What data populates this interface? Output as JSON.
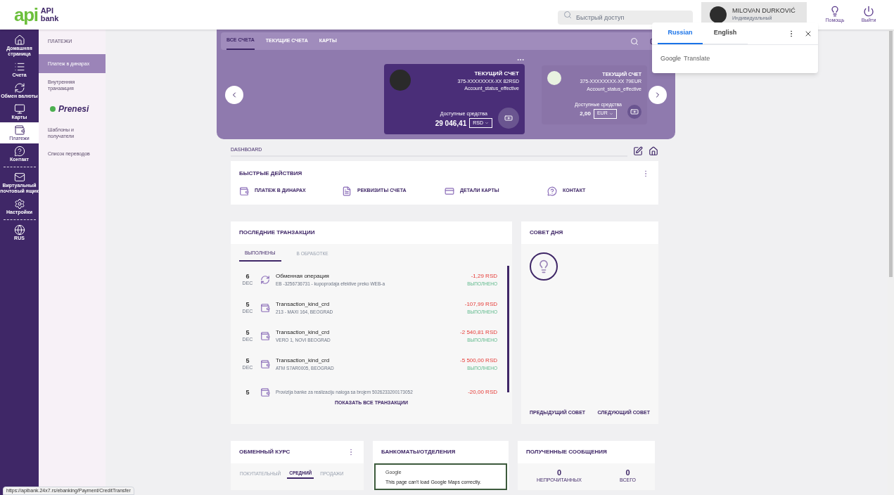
{
  "header": {
    "logo": {
      "mark": "api",
      "text": "API bank"
    },
    "search": {
      "placeholder": "Быстрый доступ"
    },
    "user": {
      "name": "MILOVAN DURKOVIĆ",
      "role": "Индивидуальный"
    },
    "actions": [
      {
        "kind": "help",
        "label": "Помощь"
      },
      {
        "kind": "logout",
        "label": "Выйти"
      }
    ]
  },
  "rail": [
    {
      "kind": "home",
      "label": "Домашняя страница",
      "selected": false,
      "separator": false
    },
    {
      "kind": "list",
      "label": "Счета",
      "selected": false,
      "separator": false
    },
    {
      "kind": "exchange",
      "label": "Обмен валюты",
      "selected": false,
      "separator": false
    },
    {
      "kind": "card",
      "label": "Карты",
      "selected": false,
      "separator": false
    },
    {
      "kind": "payment",
      "label": "Платежи",
      "selected": true,
      "separator": false
    },
    {
      "kind": "contact",
      "label": "Контакт",
      "selected": false,
      "separator": true
    },
    {
      "kind": "mail",
      "label": "Виртуальный почтовый ящик",
      "selected": false,
      "separator": false
    },
    {
      "kind": "settings",
      "label": "Настройки",
      "selected": false,
      "separator": true
    },
    {
      "kind": "globe",
      "label": "RUS",
      "selected": false,
      "separator": false
    }
  ],
  "submenu": {
    "title": "ПЛАТЕЖИ",
    "items": [
      {
        "kind": "link",
        "label": "Платеж в динарах",
        "selected": true
      },
      {
        "kind": "link",
        "label": "Внутренняя транзакция",
        "selected": false
      },
      {
        "kind": "logo",
        "label": "Prenesi",
        "selected": false
      },
      {
        "kind": "link",
        "label": "Шаблоны и получатели",
        "selected": false
      },
      {
        "kind": "link",
        "label": "Список переводов",
        "selected": false
      }
    ]
  },
  "translate_popup": {
    "tabs": [
      {
        "label": "Russian",
        "selected": true
      },
      {
        "label": "English",
        "selected": false
      }
    ],
    "footer": {
      "brand": "Google",
      "text": "Translate"
    }
  },
  "accounts": {
    "tabs": [
      {
        "label": "ВСЕ СЧЕТА",
        "selected": true
      },
      {
        "label": "ТЕКУЩИЕ СЧЕТА",
        "selected": false
      },
      {
        "label": "КАРТЫ",
        "selected": false
      }
    ],
    "cards": [
      {
        "kind": "main",
        "type": "ТЕКУЩИЙ СЧЕТ",
        "number": "375-XXXXXXXX-XX 82RSD",
        "status": "Account_status_effective",
        "available_label": "Доступные средства",
        "balance": "29 046,41",
        "currency": "RSD"
      },
      {
        "kind": "side",
        "type": "ТЕКУЩИЙ СЧЕТ",
        "number": "375-XXXXXXXX-XX 79EUR",
        "status": "Account_status_effective",
        "available_label": "Доступные средства",
        "balance": "2,00",
        "currency": "EUR"
      }
    ]
  },
  "breadcrumb": "DASHBOARD",
  "quick_actions": {
    "title": "БЫСТРЫЕ ДЕЙСТВИЯ",
    "items": [
      {
        "kind": "payment",
        "label": "ПЛАТЕЖ В ДИНАРАХ"
      },
      {
        "kind": "document",
        "label": "РЕКВИЗИТЫ СЧЕТА"
      },
      {
        "kind": "card",
        "label": "ДЕТАЛИ КАРТЫ"
      },
      {
        "kind": "contact",
        "label": "КОНТАКТ"
      }
    ]
  },
  "transactions": {
    "title": "ПОСЛЕДНИЕ ТРАНЗАКЦИИ",
    "tabs": [
      {
        "label": "ВЫПОЛНЕНЫ",
        "selected": true
      },
      {
        "label": "В ОБРАБОТКЕ",
        "selected": false
      }
    ],
    "rows": [
      {
        "kind": "exchange",
        "day": "6",
        "month": "DEC",
        "title": "Обменная операция",
        "description": "EB -3256736731 - kupoprodaja efektive preko WEB-a",
        "amount": "-1,29 RSD",
        "status": "ВЫПОЛНЕНО"
      },
      {
        "kind": "card",
        "day": "5",
        "month": "DEC",
        "title": "Transaction_kind_crd",
        "description": "213 - MAXI 164, BEOGRAD",
        "amount": "-107,99 RSD",
        "status": "ВЫПОЛНЕНО"
      },
      {
        "kind": "card",
        "day": "5",
        "month": "DEC",
        "title": "Transaction_kind_crd",
        "description": "VERO 1, NOVI BEOGRAD",
        "amount": "-2 540,81 RSD",
        "status": "ВЫПОЛНЕНО"
      },
      {
        "kind": "card",
        "day": "5",
        "month": "DEC",
        "title": "Transaction_kind_crd",
        "description": "ATM S7AR0005, BEOGRAD",
        "amount": "-5 500,00 RSD",
        "status": "ВЫПОЛНЕНО"
      },
      {
        "kind": "card",
        "day": "5",
        "description": "Provizija banke za realizaciju naloga sa brojem 5026233200173052",
        "amount": "-20,00 RSD"
      }
    ],
    "show_all": "ПОКАЗАТЬ ВСЕ ТРАНЗАКЦИИ"
  },
  "tip": {
    "title": "СОВЕТ ДНЯ",
    "prev": "ПРЕДЫДУЩИЙ СОВЕТ",
    "next": "СЛЕДУЮЩИЙ СОВЕТ"
  },
  "exchange_rate": {
    "title": "ОБМЕННЫЙ КУРС",
    "tabs": [
      {
        "label": "ПОКУПАТЕЛЬНЫЙ",
        "selected": false
      },
      {
        "label": "СРЕДНИЙ",
        "selected": true
      },
      {
        "label": "ПРОДАЖИ",
        "selected": false
      }
    ]
  },
  "atms": {
    "title": "БАНКОМАТЫ/ОТДЕЛЕНИЯ",
    "map_error": {
      "brand": "Google",
      "message": "This page can't load Google Maps correctly."
    }
  },
  "messages": {
    "title": "ПОЛУЧЕННЫЕ СООБЩЕНИЯ",
    "counts": [
      {
        "value": "0",
        "label": "НЕПРОЧИТАННЫХ"
      },
      {
        "value": "0",
        "label": "ВСЕГО"
      }
    ]
  },
  "status_bar": "https://apibank.24x7.rs/ebanking/Payment/CreditTransfer"
}
